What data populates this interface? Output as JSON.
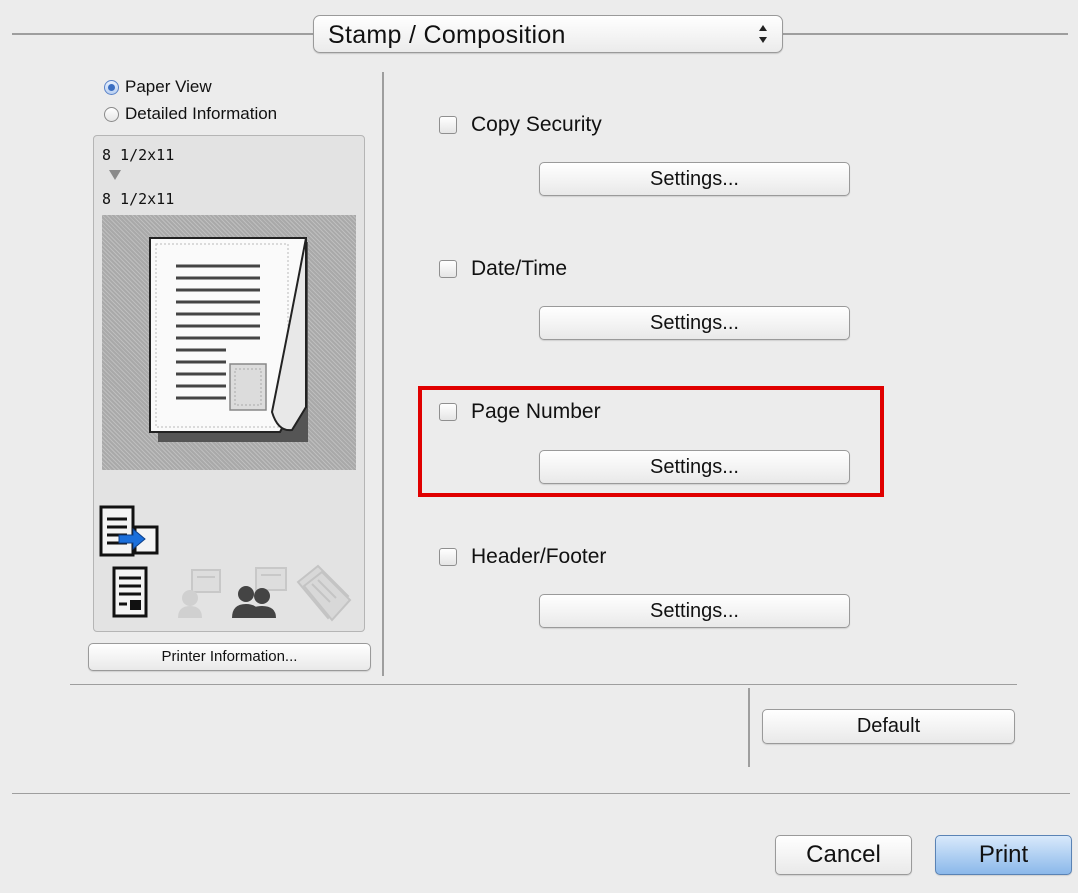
{
  "header": {
    "panel_popup_label": "Stamp / Composition"
  },
  "preview": {
    "view_options": [
      {
        "label": "Paper View",
        "selected": true
      },
      {
        "label": "Detailed Information",
        "selected": false
      }
    ],
    "original_size": "8 1/2x11",
    "output_size": "8 1/2x11",
    "printer_info_button": "Printer Information..."
  },
  "options": [
    {
      "label": "Copy Security",
      "checked": false,
      "settings_button": "Settings..."
    },
    {
      "label": "Date/Time",
      "checked": false,
      "settings_button": "Settings..."
    },
    {
      "label": "Page Number",
      "checked": false,
      "settings_button": "Settings...",
      "highlighted": true
    },
    {
      "label": "Header/Footer",
      "checked": false,
      "settings_button": "Settings..."
    }
  ],
  "footer": {
    "default_button": "Default",
    "cancel_button": "Cancel",
    "print_button": "Print"
  },
  "colors": {
    "highlight": "#e00000",
    "primary_button": "#8bb8ea",
    "radio_selected": "#3a6ec2"
  },
  "icons": [
    "popup-stepper-icon",
    "output-arrow-icon",
    "page-preview-icon",
    "printer-queue-icon",
    "document-icon",
    "user-icon",
    "user-group-icon",
    "paper-stack-icon"
  ]
}
